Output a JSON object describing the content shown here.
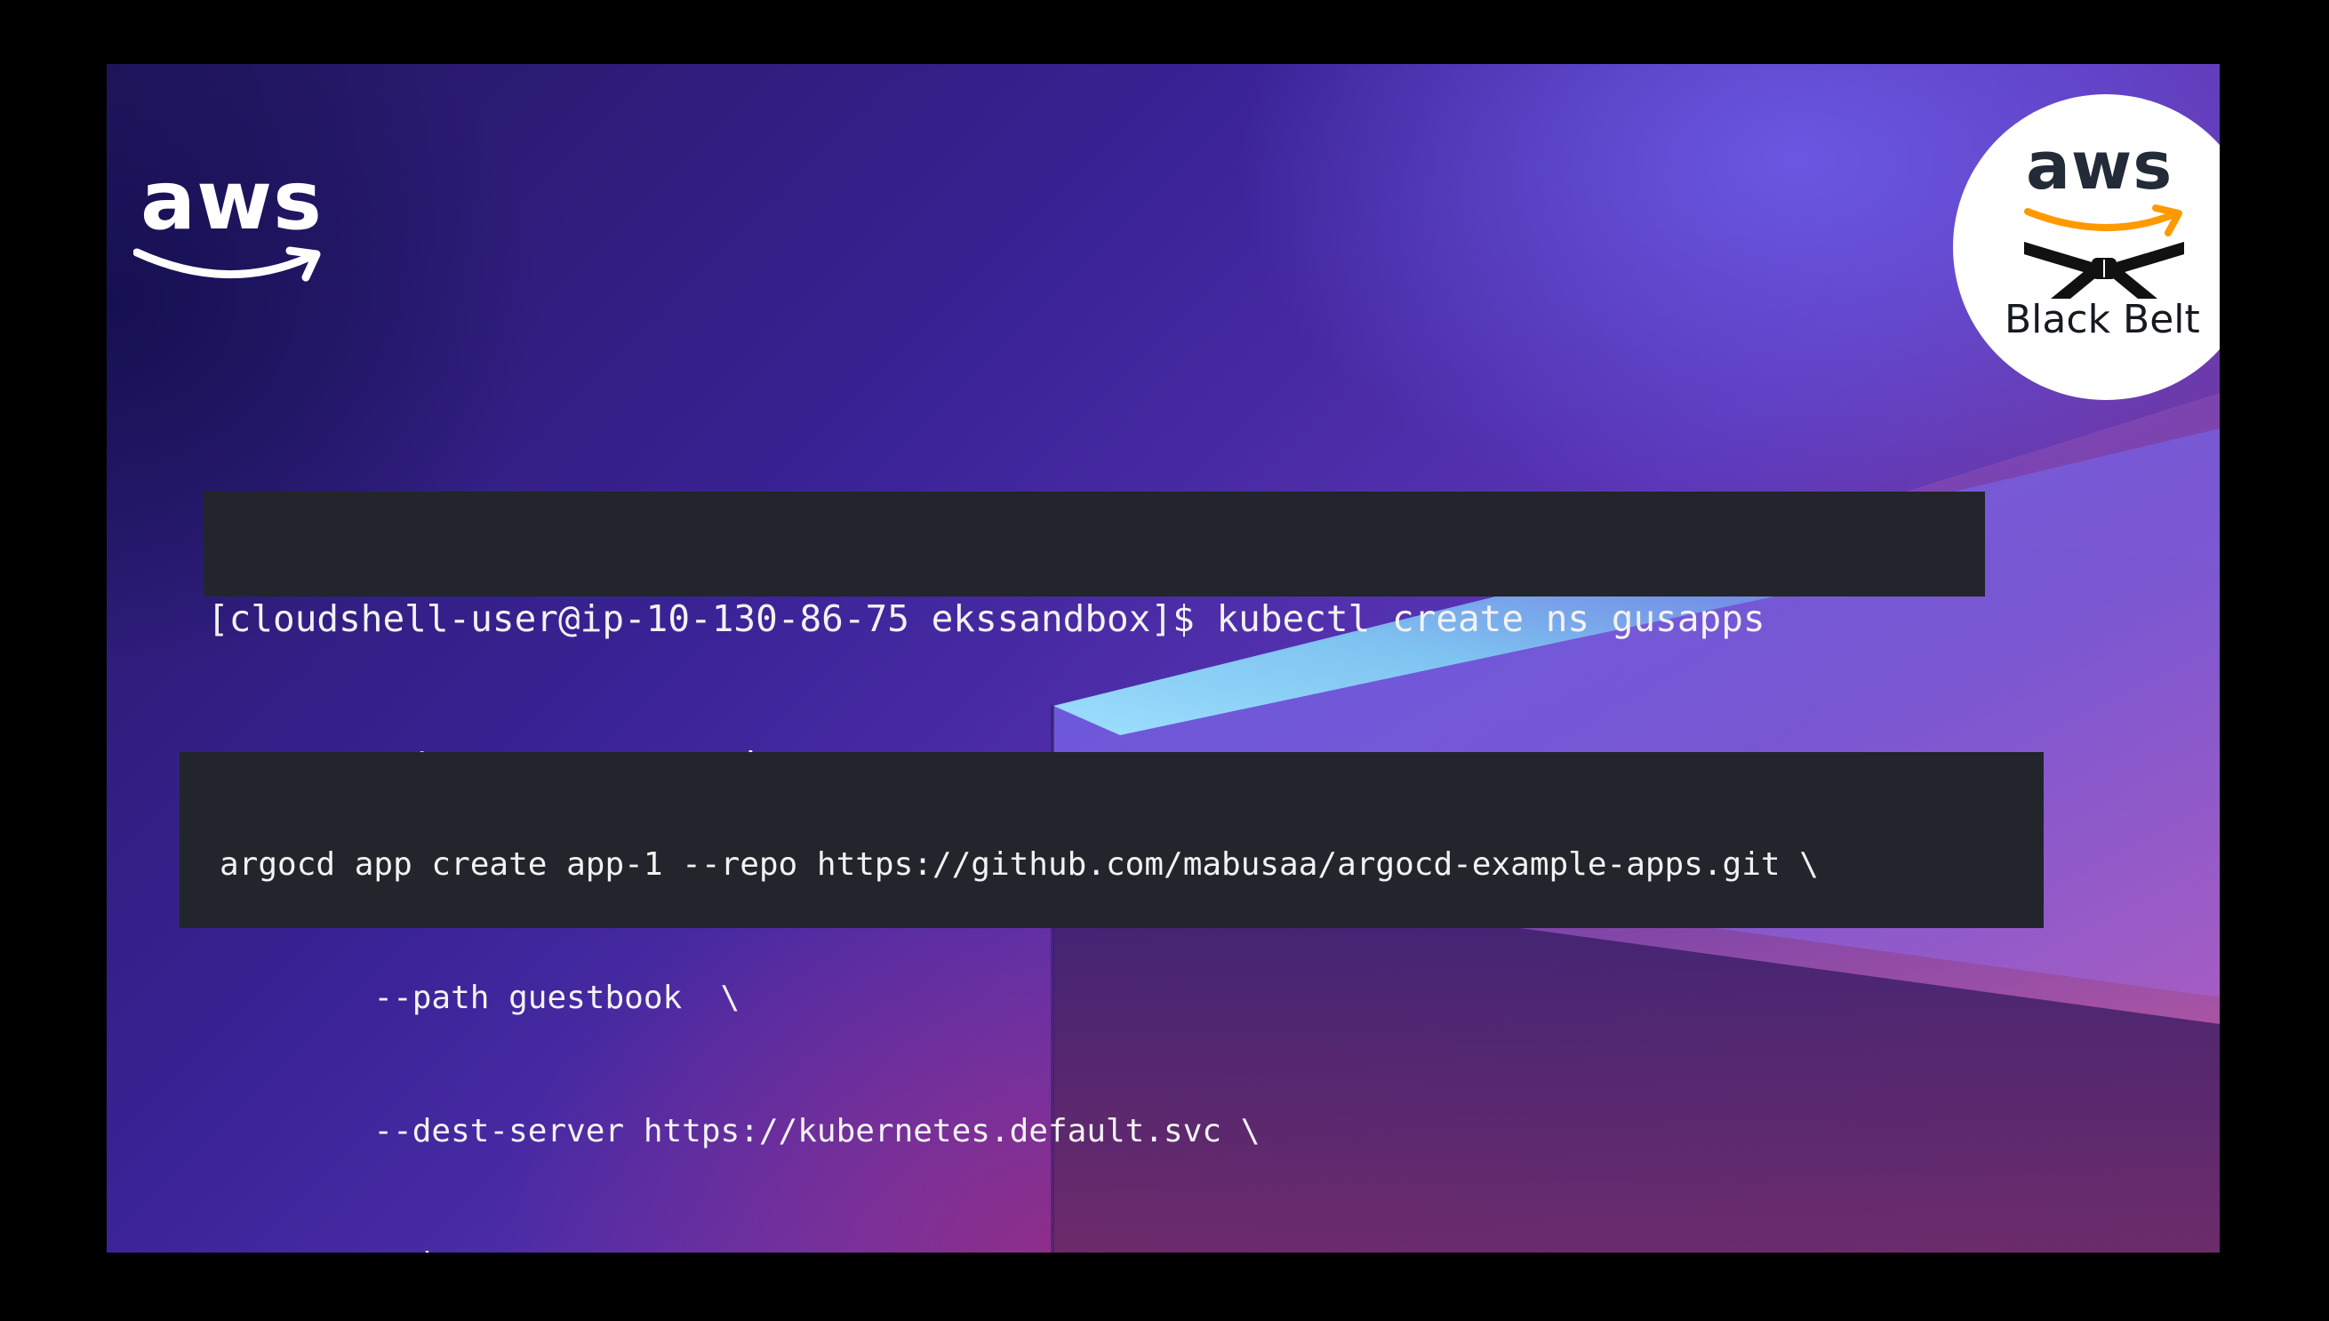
{
  "slide": {
    "colors": {
      "background": "#000000",
      "slide_purple": "#3a2396",
      "slide_magenta": "#8a3f86",
      "terminal_bg": "#22252b",
      "terminal_text": "#f2f2f2",
      "aws_orange": "#f90"
    },
    "logo": {
      "icon": "aws-logo-icon",
      "text": "aws"
    },
    "badge": {
      "icon": "aws-black-belt-badge-icon",
      "aws_text": "aws",
      "label": "Black Belt"
    },
    "terminal_1": {
      "lines": [
        "[cloudshell-user@ip-10-130-86-75 ekssandbox]$ kubectl create ns gusapps",
        "namespace/gusapps created"
      ]
    },
    "terminal_2": {
      "lines": [
        "argocd app create app-1 --repo https://github.com/mabusaa/argocd-example-apps.git \\",
        "        --path guestbook  \\",
        "        --dest-server https://kubernetes.default.svc \\",
        "        --dest-namespace gusapps"
      ]
    }
  }
}
